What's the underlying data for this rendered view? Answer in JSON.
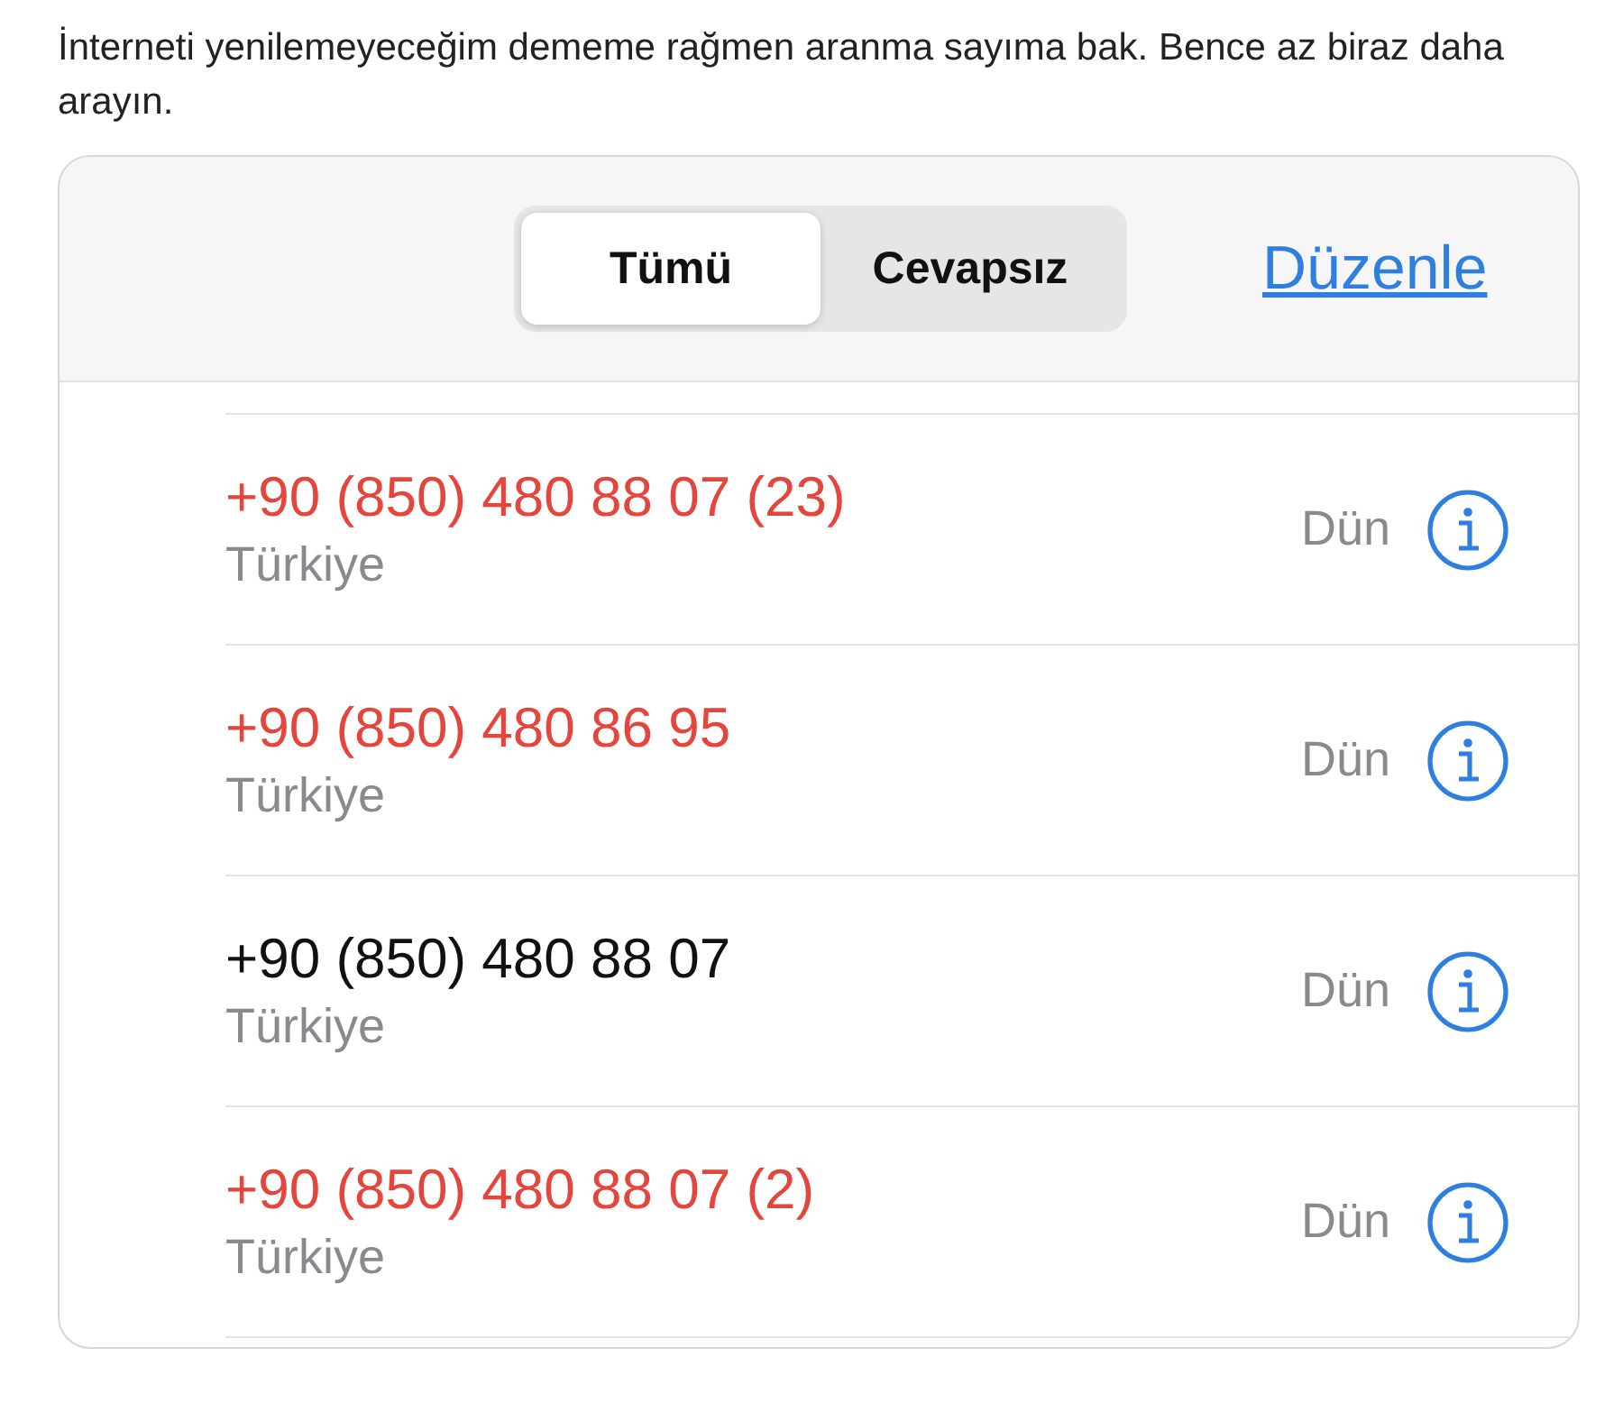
{
  "post": {
    "text": "İnterneti yenilemeyeceğim dememe rağmen aranma sayıma bak. Bence az biraz daha arayın."
  },
  "segments": [
    {
      "label": "Tümü",
      "selected": true
    },
    {
      "label": "Cevapsız",
      "selected": false
    }
  ],
  "edit_link": "Düzenle",
  "calls": [
    {
      "number": "+90 (850) 480 88 07 (23)",
      "location": "Türkiye",
      "time": "Dün",
      "missed": true
    },
    {
      "number": "+90 (850) 480 86 95",
      "location": "Türkiye",
      "time": "Dün",
      "missed": true
    },
    {
      "number": "+90 (850) 480 88 07",
      "location": "Türkiye",
      "time": "Dün",
      "missed": false
    },
    {
      "number": "+90 (850) 480 88 07 (2)",
      "location": "Türkiye",
      "time": "Dün",
      "missed": true
    }
  ]
}
